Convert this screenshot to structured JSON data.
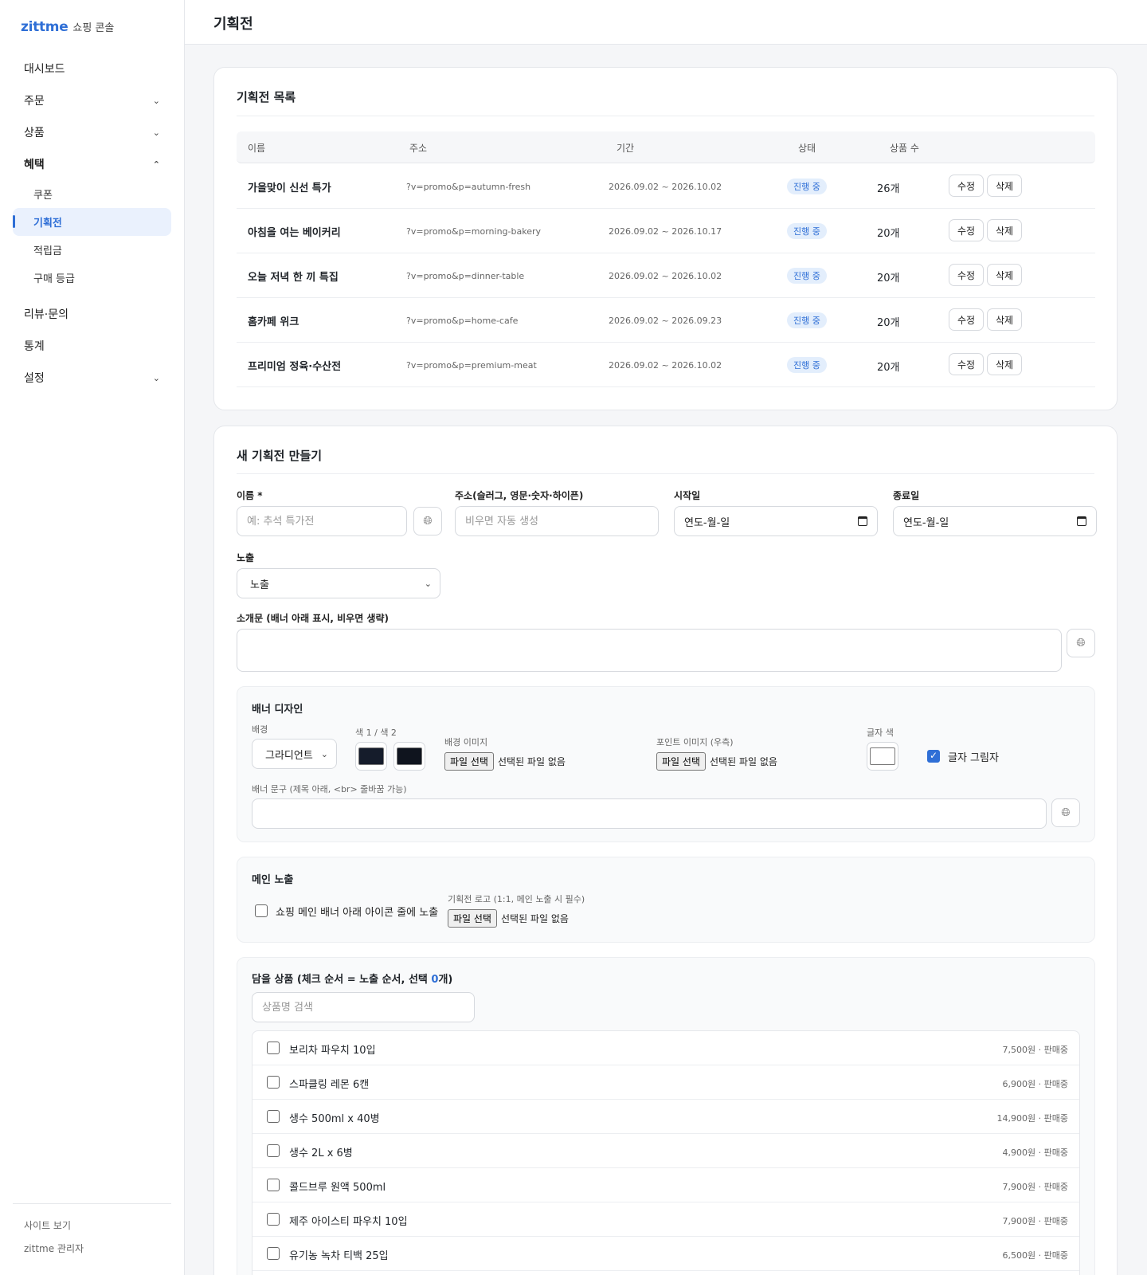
{
  "brand": {
    "logo": "zittme",
    "subtitle": "쇼핑 콘솔"
  },
  "nav": {
    "dashboard": "대시보드",
    "orders": "주문",
    "products": "상품",
    "benefits": "혜택",
    "benefits_sub": [
      "쿠폰",
      "기획전",
      "적립금",
      "구매 등급"
    ],
    "reviews": "리뷰·문의",
    "stats": "통계",
    "settings": "설정"
  },
  "footer": {
    "site_link": "사이트 보기",
    "admin": "zittme 관리자"
  },
  "page_title": "기획전",
  "list": {
    "title": "기획전 목록",
    "columns": [
      "이름",
      "주소",
      "기간",
      "상태",
      "상품 수"
    ],
    "edit_label": "수정",
    "delete_label": "삭제",
    "rows": [
      {
        "name": "가을맞이 신선 특가",
        "url": "?v=promo&p=autumn-fresh",
        "period": "2026.09.02 ~ 2026.10.02",
        "status": "진행 중",
        "count": "26개"
      },
      {
        "name": "아침을 여는 베이커리",
        "url": "?v=promo&p=morning-bakery",
        "period": "2026.09.02 ~ 2026.10.17",
        "status": "진행 중",
        "count": "20개"
      },
      {
        "name": "오늘 저녁 한 끼 특집",
        "url": "?v=promo&p=dinner-table",
        "period": "2026.09.02 ~ 2026.10.02",
        "status": "진행 중",
        "count": "20개"
      },
      {
        "name": "홈카페 위크",
        "url": "?v=promo&p=home-cafe",
        "period": "2026.09.02 ~ 2026.09.23",
        "status": "진행 중",
        "count": "20개"
      },
      {
        "name": "프리미엄 정육·수산전",
        "url": "?v=promo&p=premium-meat",
        "period": "2026.09.02 ~ 2026.10.02",
        "status": "진행 중",
        "count": "20개"
      }
    ]
  },
  "form": {
    "title": "새 기획전 만들기",
    "name_label": "이름 *",
    "name_placeholder": "예: 추석 특가전",
    "slug_label": "주소(슬러그, 영문·숫자·하이픈)",
    "slug_placeholder": "비우면 자동 생성",
    "start_label": "시작일",
    "end_label": "종료일",
    "date_placeholder": "연도-월-일",
    "exposure_label": "노출",
    "exposure_value": "노출",
    "intro_label": "소개문 (배너 아래 표시, 비우면 생략)",
    "banner": {
      "title": "배너 디자인",
      "bg_label": "배경",
      "bg_value": "그라디언트",
      "colors_label": "색 1 / 색 2",
      "color1": "#151c2b",
      "color2": "#0f141e",
      "bg_image_label": "배경 이미지",
      "point_image_label": "포인트 이미지 (우측)",
      "text_color_label": "글자 색",
      "text_color": "#ffffff",
      "shadow_label": "글자 그림자",
      "shadow_checked": true,
      "text_label": "배너 문구 (제목 아래, <br> 줄바꿈 가능)"
    },
    "file_button": "파일 선택",
    "no_file": "선택된 파일 없음",
    "main": {
      "title": "메인 노출",
      "checkbox_label": "쇼핑 메인 배너 아래 아이콘 줄에 노출",
      "logo_label": "기획전 로고 (1:1, 메인 노출 시 필수)"
    },
    "products": {
      "title_prefix": "담을 상품 (체크 순서 = 노출 순서, 선택 ",
      "selected_count": "0",
      "title_suffix": "개)",
      "search_placeholder": "상품명 검색",
      "items": [
        {
          "name": "보리차 파우치 10입",
          "meta": "7,500원 · 판매중"
        },
        {
          "name": "스파클링 레몬 6캔",
          "meta": "6,900원 · 판매중"
        },
        {
          "name": "생수 500ml x 40병",
          "meta": "14,900원 · 판매중"
        },
        {
          "name": "생수 2L x 6병",
          "meta": "4,900원 · 판매중"
        },
        {
          "name": "콜드브루 원액 500ml",
          "meta": "7,900원 · 판매중"
        },
        {
          "name": "제주 아이스티 파우치 10입",
          "meta": "7,900원 · 판매중"
        },
        {
          "name": "유기농 녹차 티백 25입",
          "meta": "6,500원 · 판매중"
        }
      ]
    }
  },
  "colors": {
    "accent": "#2f6fd6"
  }
}
